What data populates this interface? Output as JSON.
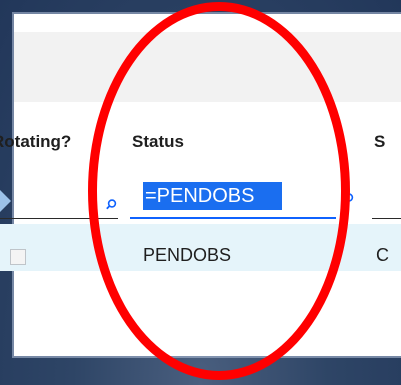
{
  "table": {
    "columns": {
      "rotating": "Rotating?",
      "status": "Status",
      "next": "S"
    },
    "filters": {
      "status_value": "=PENDOBS"
    },
    "rows": [
      {
        "status": "PENDOBS",
        "next": "C"
      }
    ]
  },
  "icons": {
    "filter_search": "search-icon"
  },
  "colors": {
    "annotation": "#ff0000",
    "selection": "#1a6ef0",
    "row_highlight": "#e5f4fa"
  }
}
